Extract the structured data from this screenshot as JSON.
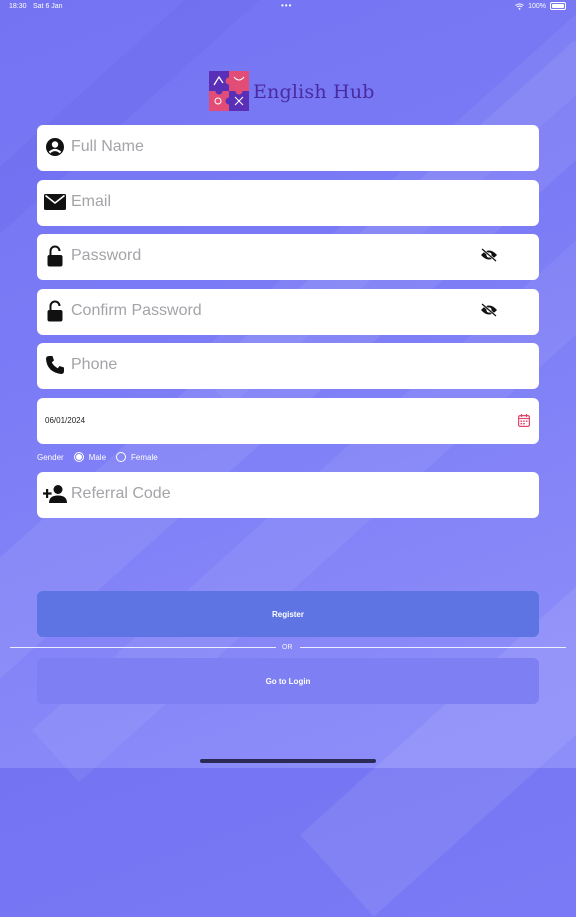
{
  "status_bar": {
    "time": "18:30",
    "date": "Sat 6 Jan",
    "battery": "100%"
  },
  "logo": {
    "title": "English Hub"
  },
  "fields": {
    "full_name": {
      "placeholder": "Full Name",
      "icon": "person-icon"
    },
    "email": {
      "placeholder": "Email",
      "icon": "envelope-icon"
    },
    "password": {
      "placeholder": "Password",
      "icon": "unlock-icon",
      "toggle_icon": "eye-slash-icon"
    },
    "confirm_password": {
      "placeholder": "Confirm Password",
      "icon": "unlock-icon",
      "toggle_icon": "eye-slash-icon"
    },
    "phone": {
      "placeholder": "Phone",
      "icon": "phone-icon"
    },
    "date": {
      "value": "06/01/2024",
      "icon": "calendar-icon"
    },
    "referral": {
      "placeholder": "Referral Code",
      "icon": "person-add-icon"
    }
  },
  "gender": {
    "label": "Gender",
    "options": [
      "Male",
      "Female"
    ],
    "selected": "Male"
  },
  "buttons": {
    "register": "Register",
    "or": "OR",
    "login": "Go to Login"
  },
  "colors": {
    "accent_calendar": "#e0476b",
    "register_button": "#5e74e2",
    "login_button": "#7d7ff2",
    "logo_text": "#4a2aa0"
  }
}
